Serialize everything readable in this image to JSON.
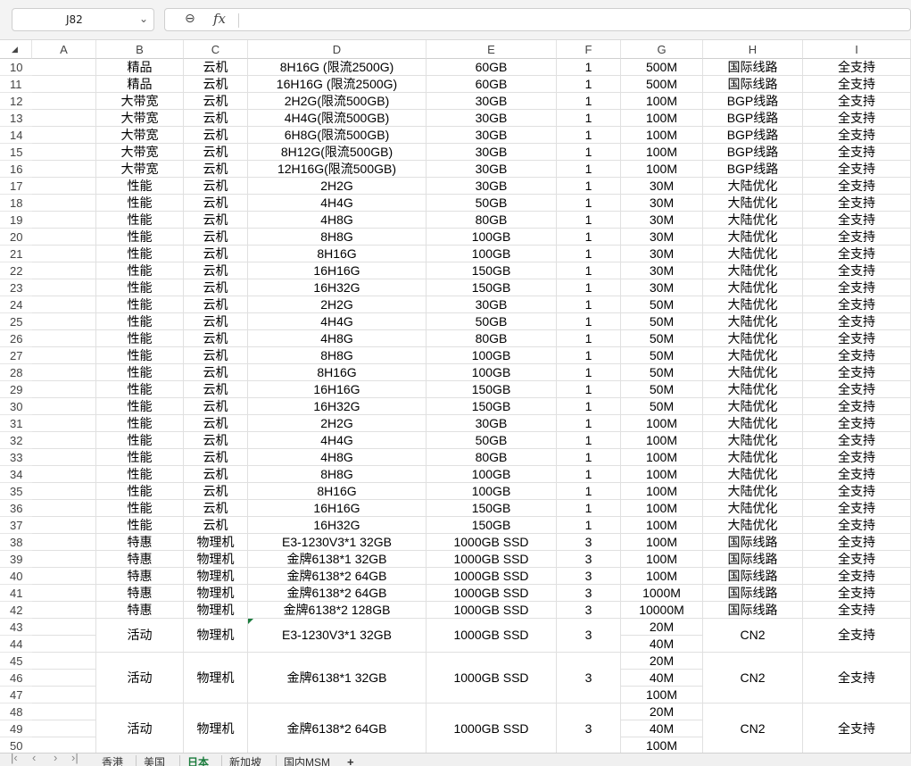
{
  "formula_bar": {
    "cell_ref": "J82",
    "fx_label": "fx"
  },
  "columns": [
    "A",
    "B",
    "C",
    "D",
    "E",
    "F",
    "G",
    "H",
    "I"
  ],
  "rows": [
    {
      "n": "10",
      "b": "精品",
      "c": "云机",
      "d": "8H16G (限流2500G)",
      "e": "60GB",
      "f": "1",
      "g": "500M",
      "h": "国际线路",
      "i": "全支持"
    },
    {
      "n": "11",
      "b": "精品",
      "c": "云机",
      "d": "16H16G (限流2500G)",
      "e": "60GB",
      "f": "1",
      "g": "500M",
      "h": "国际线路",
      "i": "全支持"
    },
    {
      "n": "12",
      "b": "大带宽",
      "c": "云机",
      "d": "2H2G(限流500GB)",
      "e": "30GB",
      "f": "1",
      "g": "100M",
      "h": "BGP线路",
      "i": "全支持"
    },
    {
      "n": "13",
      "b": "大带宽",
      "c": "云机",
      "d": "4H4G(限流500GB)",
      "e": "30GB",
      "f": "1",
      "g": "100M",
      "h": "BGP线路",
      "i": "全支持"
    },
    {
      "n": "14",
      "b": "大带宽",
      "c": "云机",
      "d": "6H8G(限流500GB)",
      "e": "30GB",
      "f": "1",
      "g": "100M",
      "h": "BGP线路",
      "i": "全支持"
    },
    {
      "n": "15",
      "b": "大带宽",
      "c": "云机",
      "d": "8H12G(限流500GB)",
      "e": "30GB",
      "f": "1",
      "g": "100M",
      "h": "BGP线路",
      "i": "全支持"
    },
    {
      "n": "16",
      "b": "大带宽",
      "c": "云机",
      "d": "12H16G(限流500GB)",
      "e": "30GB",
      "f": "1",
      "g": "100M",
      "h": "BGP线路",
      "i": "全支持"
    },
    {
      "n": "17",
      "b": "性能",
      "c": "云机",
      "d": "2H2G",
      "e": "30GB",
      "f": "1",
      "g": "30M",
      "h": "大陆优化",
      "i": "全支持"
    },
    {
      "n": "18",
      "b": "性能",
      "c": "云机",
      "d": "4H4G",
      "e": "50GB",
      "f": "1",
      "g": "30M",
      "h": "大陆优化",
      "i": "全支持"
    },
    {
      "n": "19",
      "b": "性能",
      "c": "云机",
      "d": "4H8G",
      "e": "80GB",
      "f": "1",
      "g": "30M",
      "h": "大陆优化",
      "i": "全支持"
    },
    {
      "n": "20",
      "b": "性能",
      "c": "云机",
      "d": "8H8G",
      "e": "100GB",
      "f": "1",
      "g": "30M",
      "h": "大陆优化",
      "i": "全支持"
    },
    {
      "n": "21",
      "b": "性能",
      "c": "云机",
      "d": "8H16G",
      "e": "100GB",
      "f": "1",
      "g": "30M",
      "h": "大陆优化",
      "i": "全支持"
    },
    {
      "n": "22",
      "b": "性能",
      "c": "云机",
      "d": "16H16G",
      "e": "150GB",
      "f": "1",
      "g": "30M",
      "h": "大陆优化",
      "i": "全支持"
    },
    {
      "n": "23",
      "b": "性能",
      "c": "云机",
      "d": "16H32G",
      "e": "150GB",
      "f": "1",
      "g": "30M",
      "h": "大陆优化",
      "i": "全支持"
    },
    {
      "n": "24",
      "b": "性能",
      "c": "云机",
      "d": "2H2G",
      "e": "30GB",
      "f": "1",
      "g": "50M",
      "h": "大陆优化",
      "i": "全支持"
    },
    {
      "n": "25",
      "b": "性能",
      "c": "云机",
      "d": "4H4G",
      "e": "50GB",
      "f": "1",
      "g": "50M",
      "h": "大陆优化",
      "i": "全支持"
    },
    {
      "n": "26",
      "b": "性能",
      "c": "云机",
      "d": "4H8G",
      "e": "80GB",
      "f": "1",
      "g": "50M",
      "h": "大陆优化",
      "i": "全支持"
    },
    {
      "n": "27",
      "b": "性能",
      "c": "云机",
      "d": "8H8G",
      "e": "100GB",
      "f": "1",
      "g": "50M",
      "h": "大陆优化",
      "i": "全支持"
    },
    {
      "n": "28",
      "b": "性能",
      "c": "云机",
      "d": "8H16G",
      "e": "100GB",
      "f": "1",
      "g": "50M",
      "h": "大陆优化",
      "i": "全支持"
    },
    {
      "n": "29",
      "b": "性能",
      "c": "云机",
      "d": "16H16G",
      "e": "150GB",
      "f": "1",
      "g": "50M",
      "h": "大陆优化",
      "i": "全支持"
    },
    {
      "n": "30",
      "b": "性能",
      "c": "云机",
      "d": "16H32G",
      "e": "150GB",
      "f": "1",
      "g": "50M",
      "h": "大陆优化",
      "i": "全支持"
    },
    {
      "n": "31",
      "b": "性能",
      "c": "云机",
      "d": "2H2G",
      "e": "30GB",
      "f": "1",
      "g": "100M",
      "h": "大陆优化",
      "i": "全支持"
    },
    {
      "n": "32",
      "b": "性能",
      "c": "云机",
      "d": "4H4G",
      "e": "50GB",
      "f": "1",
      "g": "100M",
      "h": "大陆优化",
      "i": "全支持"
    },
    {
      "n": "33",
      "b": "性能",
      "c": "云机",
      "d": "4H8G",
      "e": "80GB",
      "f": "1",
      "g": "100M",
      "h": "大陆优化",
      "i": "全支持"
    },
    {
      "n": "34",
      "b": "性能",
      "c": "云机",
      "d": "8H8G",
      "e": "100GB",
      "f": "1",
      "g": "100M",
      "h": "大陆优化",
      "i": "全支持"
    },
    {
      "n": "35",
      "b": "性能",
      "c": "云机",
      "d": "8H16G",
      "e": "100GB",
      "f": "1",
      "g": "100M",
      "h": "大陆优化",
      "i": "全支持"
    },
    {
      "n": "36",
      "b": "性能",
      "c": "云机",
      "d": "16H16G",
      "e": "150GB",
      "f": "1",
      "g": "100M",
      "h": "大陆优化",
      "i": "全支持"
    },
    {
      "n": "37",
      "b": "性能",
      "c": "云机",
      "d": "16H32G",
      "e": "150GB",
      "f": "1",
      "g": "100M",
      "h": "大陆优化",
      "i": "全支持"
    },
    {
      "n": "38",
      "b": "特惠",
      "c": "物理机",
      "d": "E3-1230V3*1 32GB",
      "e": "1000GB SSD",
      "f": "3",
      "g": "100M",
      "h": "国际线路",
      "i": "全支持"
    },
    {
      "n": "39",
      "b": "特惠",
      "c": "物理机",
      "d": "金牌6138*1 32GB",
      "e": "1000GB SSD",
      "f": "3",
      "g": "100M",
      "h": "国际线路",
      "i": "全支持"
    },
    {
      "n": "40",
      "b": "特惠",
      "c": "物理机",
      "d": "金牌6138*2 64GB",
      "e": "1000GB SSD",
      "f": "3",
      "g": "100M",
      "h": "国际线路",
      "i": "全支持"
    },
    {
      "n": "41",
      "b": "特惠",
      "c": "物理机",
      "d": "金牌6138*2 64GB",
      "e": "1000GB SSD",
      "f": "3",
      "g": "1000M",
      "h": "国际线路",
      "i": "全支持"
    },
    {
      "n": "42",
      "b": "特惠",
      "c": "物理机",
      "d": "金牌6138*2 128GB",
      "e": "1000GB SSD",
      "f": "3",
      "g": "10000M",
      "h": "国际线路",
      "i": "全支持"
    }
  ],
  "merged_groups": [
    {
      "rows": [
        "43",
        "44"
      ],
      "b": "活动",
      "c": "物理机",
      "d": "E3-1230V3*1 32GB",
      "e": "1000GB SSD",
      "f": "3",
      "g": [
        "20M",
        "40M"
      ],
      "h": "CN2",
      "i": "全支持"
    },
    {
      "rows": [
        "45",
        "46",
        "47"
      ],
      "b": "活动",
      "c": "物理机",
      "d": "金牌6138*1 32GB",
      "e": "1000GB SSD",
      "f": "3",
      "g": [
        "20M",
        "40M",
        "100M"
      ],
      "h": "CN2",
      "i": "全支持"
    },
    {
      "rows": [
        "48",
        "49",
        "50"
      ],
      "b": "活动",
      "c": "物理机",
      "d": "金牌6138*2 64GB",
      "e": "1000GB SSD",
      "f": "3",
      "g": [
        "20M",
        "40M",
        "100M"
      ],
      "h": "CN2",
      "i": "全支持"
    }
  ],
  "sheet_tabs": [
    "香港",
    "美国",
    "日本",
    "新加坡",
    "国内MSM"
  ],
  "active_tab": "日本",
  "add_tab_label": "+"
}
